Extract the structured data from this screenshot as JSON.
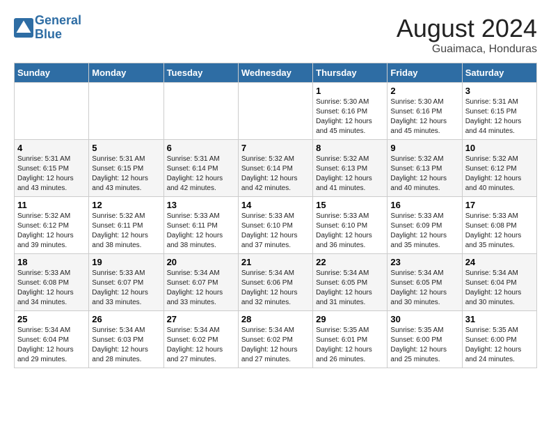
{
  "header": {
    "logo_line1": "General",
    "logo_line2": "Blue",
    "title": "August 2024",
    "subtitle": "Guaimaca, Honduras"
  },
  "days_of_week": [
    "Sunday",
    "Monday",
    "Tuesday",
    "Wednesday",
    "Thursday",
    "Friday",
    "Saturday"
  ],
  "weeks": [
    [
      {
        "day": "",
        "info": ""
      },
      {
        "day": "",
        "info": ""
      },
      {
        "day": "",
        "info": ""
      },
      {
        "day": "",
        "info": ""
      },
      {
        "day": "1",
        "info": "Sunrise: 5:30 AM\nSunset: 6:16 PM\nDaylight: 12 hours\nand 45 minutes."
      },
      {
        "day": "2",
        "info": "Sunrise: 5:30 AM\nSunset: 6:16 PM\nDaylight: 12 hours\nand 45 minutes."
      },
      {
        "day": "3",
        "info": "Sunrise: 5:31 AM\nSunset: 6:15 PM\nDaylight: 12 hours\nand 44 minutes."
      }
    ],
    [
      {
        "day": "4",
        "info": "Sunrise: 5:31 AM\nSunset: 6:15 PM\nDaylight: 12 hours\nand 43 minutes."
      },
      {
        "day": "5",
        "info": "Sunrise: 5:31 AM\nSunset: 6:15 PM\nDaylight: 12 hours\nand 43 minutes."
      },
      {
        "day": "6",
        "info": "Sunrise: 5:31 AM\nSunset: 6:14 PM\nDaylight: 12 hours\nand 42 minutes."
      },
      {
        "day": "7",
        "info": "Sunrise: 5:32 AM\nSunset: 6:14 PM\nDaylight: 12 hours\nand 42 minutes."
      },
      {
        "day": "8",
        "info": "Sunrise: 5:32 AM\nSunset: 6:13 PM\nDaylight: 12 hours\nand 41 minutes."
      },
      {
        "day": "9",
        "info": "Sunrise: 5:32 AM\nSunset: 6:13 PM\nDaylight: 12 hours\nand 40 minutes."
      },
      {
        "day": "10",
        "info": "Sunrise: 5:32 AM\nSunset: 6:12 PM\nDaylight: 12 hours\nand 40 minutes."
      }
    ],
    [
      {
        "day": "11",
        "info": "Sunrise: 5:32 AM\nSunset: 6:12 PM\nDaylight: 12 hours\nand 39 minutes."
      },
      {
        "day": "12",
        "info": "Sunrise: 5:32 AM\nSunset: 6:11 PM\nDaylight: 12 hours\nand 38 minutes."
      },
      {
        "day": "13",
        "info": "Sunrise: 5:33 AM\nSunset: 6:11 PM\nDaylight: 12 hours\nand 38 minutes."
      },
      {
        "day": "14",
        "info": "Sunrise: 5:33 AM\nSunset: 6:10 PM\nDaylight: 12 hours\nand 37 minutes."
      },
      {
        "day": "15",
        "info": "Sunrise: 5:33 AM\nSunset: 6:10 PM\nDaylight: 12 hours\nand 36 minutes."
      },
      {
        "day": "16",
        "info": "Sunrise: 5:33 AM\nSunset: 6:09 PM\nDaylight: 12 hours\nand 35 minutes."
      },
      {
        "day": "17",
        "info": "Sunrise: 5:33 AM\nSunset: 6:08 PM\nDaylight: 12 hours\nand 35 minutes."
      }
    ],
    [
      {
        "day": "18",
        "info": "Sunrise: 5:33 AM\nSunset: 6:08 PM\nDaylight: 12 hours\nand 34 minutes."
      },
      {
        "day": "19",
        "info": "Sunrise: 5:33 AM\nSunset: 6:07 PM\nDaylight: 12 hours\nand 33 minutes."
      },
      {
        "day": "20",
        "info": "Sunrise: 5:34 AM\nSunset: 6:07 PM\nDaylight: 12 hours\nand 33 minutes."
      },
      {
        "day": "21",
        "info": "Sunrise: 5:34 AM\nSunset: 6:06 PM\nDaylight: 12 hours\nand 32 minutes."
      },
      {
        "day": "22",
        "info": "Sunrise: 5:34 AM\nSunset: 6:05 PM\nDaylight: 12 hours\nand 31 minutes."
      },
      {
        "day": "23",
        "info": "Sunrise: 5:34 AM\nSunset: 6:05 PM\nDaylight: 12 hours\nand 30 minutes."
      },
      {
        "day": "24",
        "info": "Sunrise: 5:34 AM\nSunset: 6:04 PM\nDaylight: 12 hours\nand 30 minutes."
      }
    ],
    [
      {
        "day": "25",
        "info": "Sunrise: 5:34 AM\nSunset: 6:04 PM\nDaylight: 12 hours\nand 29 minutes."
      },
      {
        "day": "26",
        "info": "Sunrise: 5:34 AM\nSunset: 6:03 PM\nDaylight: 12 hours\nand 28 minutes."
      },
      {
        "day": "27",
        "info": "Sunrise: 5:34 AM\nSunset: 6:02 PM\nDaylight: 12 hours\nand 27 minutes."
      },
      {
        "day": "28",
        "info": "Sunrise: 5:34 AM\nSunset: 6:02 PM\nDaylight: 12 hours\nand 27 minutes."
      },
      {
        "day": "29",
        "info": "Sunrise: 5:35 AM\nSunset: 6:01 PM\nDaylight: 12 hours\nand 26 minutes."
      },
      {
        "day": "30",
        "info": "Sunrise: 5:35 AM\nSunset: 6:00 PM\nDaylight: 12 hours\nand 25 minutes."
      },
      {
        "day": "31",
        "info": "Sunrise: 5:35 AM\nSunset: 6:00 PM\nDaylight: 12 hours\nand 24 minutes."
      }
    ]
  ]
}
